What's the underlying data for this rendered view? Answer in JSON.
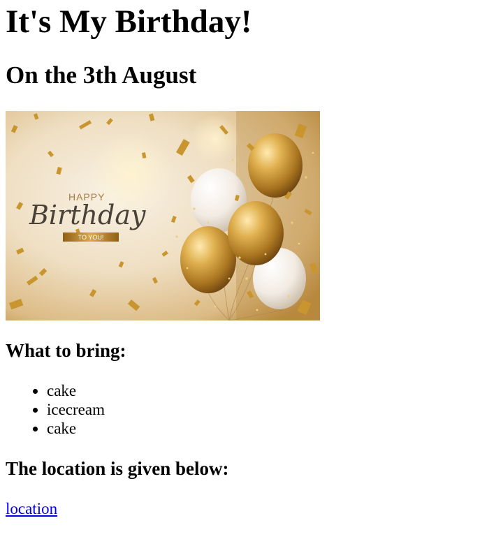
{
  "page": {
    "title": "It's My Birthday!",
    "subtitle": "On the 3th August",
    "image": {
      "happy_text": "HAPPY",
      "birthday_text": "Birthday",
      "ribbon_text": "TO YOU!",
      "colors": {
        "background_light": "#f3e7d2",
        "background_warm": "#d9b37a",
        "gold": "#c9952f",
        "gold_dark": "#8a5a14",
        "balloon_white": "#f4efe9",
        "ribbon": "#b88423",
        "script_text": "#4a4238",
        "happy_text_color": "#a27b45"
      }
    },
    "bring": {
      "heading": "What to bring:",
      "items": [
        "cake",
        "icecream",
        "cake"
      ]
    },
    "location": {
      "heading": "The location is given below:",
      "link_text": "location",
      "link_color": "#0000ee"
    }
  }
}
